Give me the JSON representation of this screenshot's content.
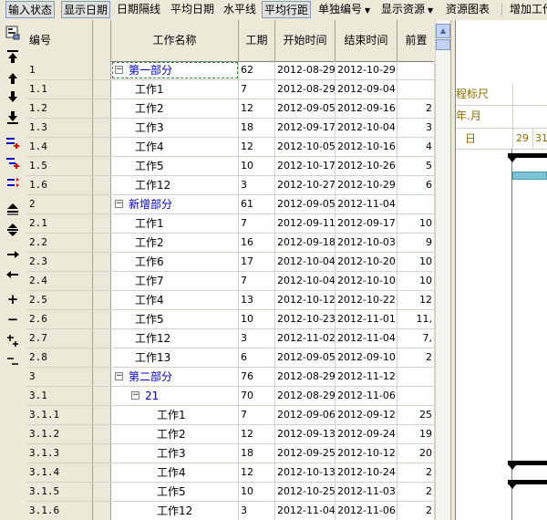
{
  "toolbar": {
    "buttons": [
      {
        "label": "输入状态",
        "pressed": true
      },
      {
        "label": "显示日期",
        "pressed": true
      },
      {
        "label": "日期隔线",
        "pressed": false
      },
      {
        "label": "平均日期",
        "pressed": false
      },
      {
        "label": "水平线",
        "pressed": false
      },
      {
        "label": "平均行距",
        "pressed": true
      },
      {
        "label": "单独编号",
        "pressed": false,
        "dropdown": true
      },
      {
        "label": "显示资源",
        "pressed": false,
        "dropdown": true
      },
      {
        "label": "资源图表",
        "pressed": false
      },
      {
        "label": "增加工作",
        "pressed": false
      }
    ]
  },
  "icon_strip": [
    "layout-icon",
    "move-to-top-icon",
    "move-up-icon",
    "move-down-icon",
    "move-to-bottom-icon",
    "insert-below-icon",
    "insert-child-icon",
    "link-tasks-icon",
    "collapse-all-icon",
    "expand-all-icon",
    "indent-icon",
    "outdent-icon",
    "zoom-in-icon",
    "zoom-out-icon",
    "add-subtask-icon",
    "remove-subtask-icon"
  ],
  "grid": {
    "columns": {
      "id": "编号",
      "name": "工作名称",
      "duration": "工期",
      "start": "开始时间",
      "end": "结束时间",
      "pred": "前置"
    },
    "rows": [
      {
        "id": "1",
        "name": "第一部分",
        "level": 0,
        "group": true,
        "expanded": true,
        "selected": true,
        "duration": "62",
        "start": "2012-08-29",
        "end": "2012-10-29",
        "pred": ""
      },
      {
        "id": "1.1",
        "name": "工作1",
        "level": 1,
        "group": false,
        "duration": "7",
        "start": "2012-08-29",
        "end": "2012-09-04",
        "pred": ""
      },
      {
        "id": "1.2",
        "name": "工作2",
        "level": 1,
        "group": false,
        "duration": "12",
        "start": "2012-09-05",
        "end": "2012-09-16",
        "pred": "2"
      },
      {
        "id": "1.3",
        "name": "工作3",
        "level": 1,
        "group": false,
        "duration": "18",
        "start": "2012-09-17",
        "end": "2012-10-04",
        "pred": "3"
      },
      {
        "id": "1.4",
        "name": "工作4",
        "level": 1,
        "group": false,
        "duration": "12",
        "start": "2012-10-05",
        "end": "2012-10-16",
        "pred": "4"
      },
      {
        "id": "1.5",
        "name": "工作5",
        "level": 1,
        "group": false,
        "duration": "10",
        "start": "2012-10-17",
        "end": "2012-10-26",
        "pred": "5"
      },
      {
        "id": "1.6",
        "name": "工作12",
        "level": 1,
        "group": false,
        "duration": "3",
        "start": "2012-10-27",
        "end": "2012-10-29",
        "pred": "6"
      },
      {
        "id": "2",
        "name": "新增部分",
        "level": 0,
        "group": true,
        "expanded": true,
        "selected": false,
        "duration": "61",
        "start": "2012-09-05",
        "end": "2012-11-04",
        "pred": ""
      },
      {
        "id": "2.1",
        "name": "工作1",
        "level": 1,
        "group": false,
        "duration": "7",
        "start": "2012-09-11",
        "end": "2012-09-17",
        "pred": "10"
      },
      {
        "id": "2.2",
        "name": "工作2",
        "level": 1,
        "group": false,
        "duration": "16",
        "start": "2012-09-18",
        "end": "2012-10-03",
        "pred": "9"
      },
      {
        "id": "2.3",
        "name": "工作6",
        "level": 1,
        "group": false,
        "duration": "17",
        "start": "2012-10-04",
        "end": "2012-10-20",
        "pred": "10"
      },
      {
        "id": "2.4",
        "name": "工作7",
        "level": 1,
        "group": false,
        "duration": "7",
        "start": "2012-10-04",
        "end": "2012-10-10",
        "pred": "10"
      },
      {
        "id": "2.5",
        "name": "工作4",
        "level": 1,
        "group": false,
        "duration": "13",
        "start": "2012-10-12",
        "end": "2012-10-22",
        "pred": "12"
      },
      {
        "id": "2.6",
        "name": "工作5",
        "level": 1,
        "group": false,
        "duration": "10",
        "start": "2012-10-23",
        "end": "2012-11-01",
        "pred": "11,"
      },
      {
        "id": "2.7",
        "name": "工作12",
        "level": 1,
        "group": false,
        "duration": "3",
        "start": "2012-11-02",
        "end": "2012-11-04",
        "pred": "7,"
      },
      {
        "id": "2.8",
        "name": "工作13",
        "level": 1,
        "group": false,
        "duration": "6",
        "start": "2012-09-05",
        "end": "2012-09-10",
        "pred": "2"
      },
      {
        "id": "3",
        "name": "第二部分",
        "level": 0,
        "group": true,
        "expanded": true,
        "selected": false,
        "duration": "76",
        "start": "2012-08-29",
        "end": "2012-11-12",
        "pred": ""
      },
      {
        "id": "3.1",
        "name": "21",
        "level": 1,
        "group": true,
        "expanded": true,
        "selected": false,
        "duration": "70",
        "start": "2012-08-29",
        "end": "2012-11-06",
        "pred": ""
      },
      {
        "id": "3.1.1",
        "name": "工作1",
        "level": 2,
        "group": false,
        "duration": "7",
        "start": "2012-09-06",
        "end": "2012-09-12",
        "pred": "25"
      },
      {
        "id": "3.1.2",
        "name": "工作2",
        "level": 2,
        "group": false,
        "duration": "12",
        "start": "2012-09-13",
        "end": "2012-09-24",
        "pred": "19"
      },
      {
        "id": "3.1.3",
        "name": "工作3",
        "level": 2,
        "group": false,
        "duration": "18",
        "start": "2012-09-25",
        "end": "2012-10-12",
        "pred": "20"
      },
      {
        "id": "3.1.4",
        "name": "工作4",
        "level": 2,
        "group": false,
        "duration": "12",
        "start": "2012-10-13",
        "end": "2012-10-24",
        "pred": "2"
      },
      {
        "id": "3.1.5",
        "name": "工作5",
        "level": 2,
        "group": false,
        "duration": "10",
        "start": "2012-10-25",
        "end": "2012-11-03",
        "pred": "2"
      },
      {
        "id": "3.1.6",
        "name": "工作12",
        "level": 2,
        "group": false,
        "duration": "3",
        "start": "2012-11-04",
        "end": "2012-11-06",
        "pred": "2"
      }
    ]
  },
  "gantt": {
    "scale_title": "程标尺",
    "year_month": "年.月",
    "day_label": "日",
    "days": [
      "29",
      "31"
    ],
    "colors": {
      "today_line": "#e85050",
      "task_bar": "#7ec3d6",
      "summary_bar": "#000000"
    }
  }
}
